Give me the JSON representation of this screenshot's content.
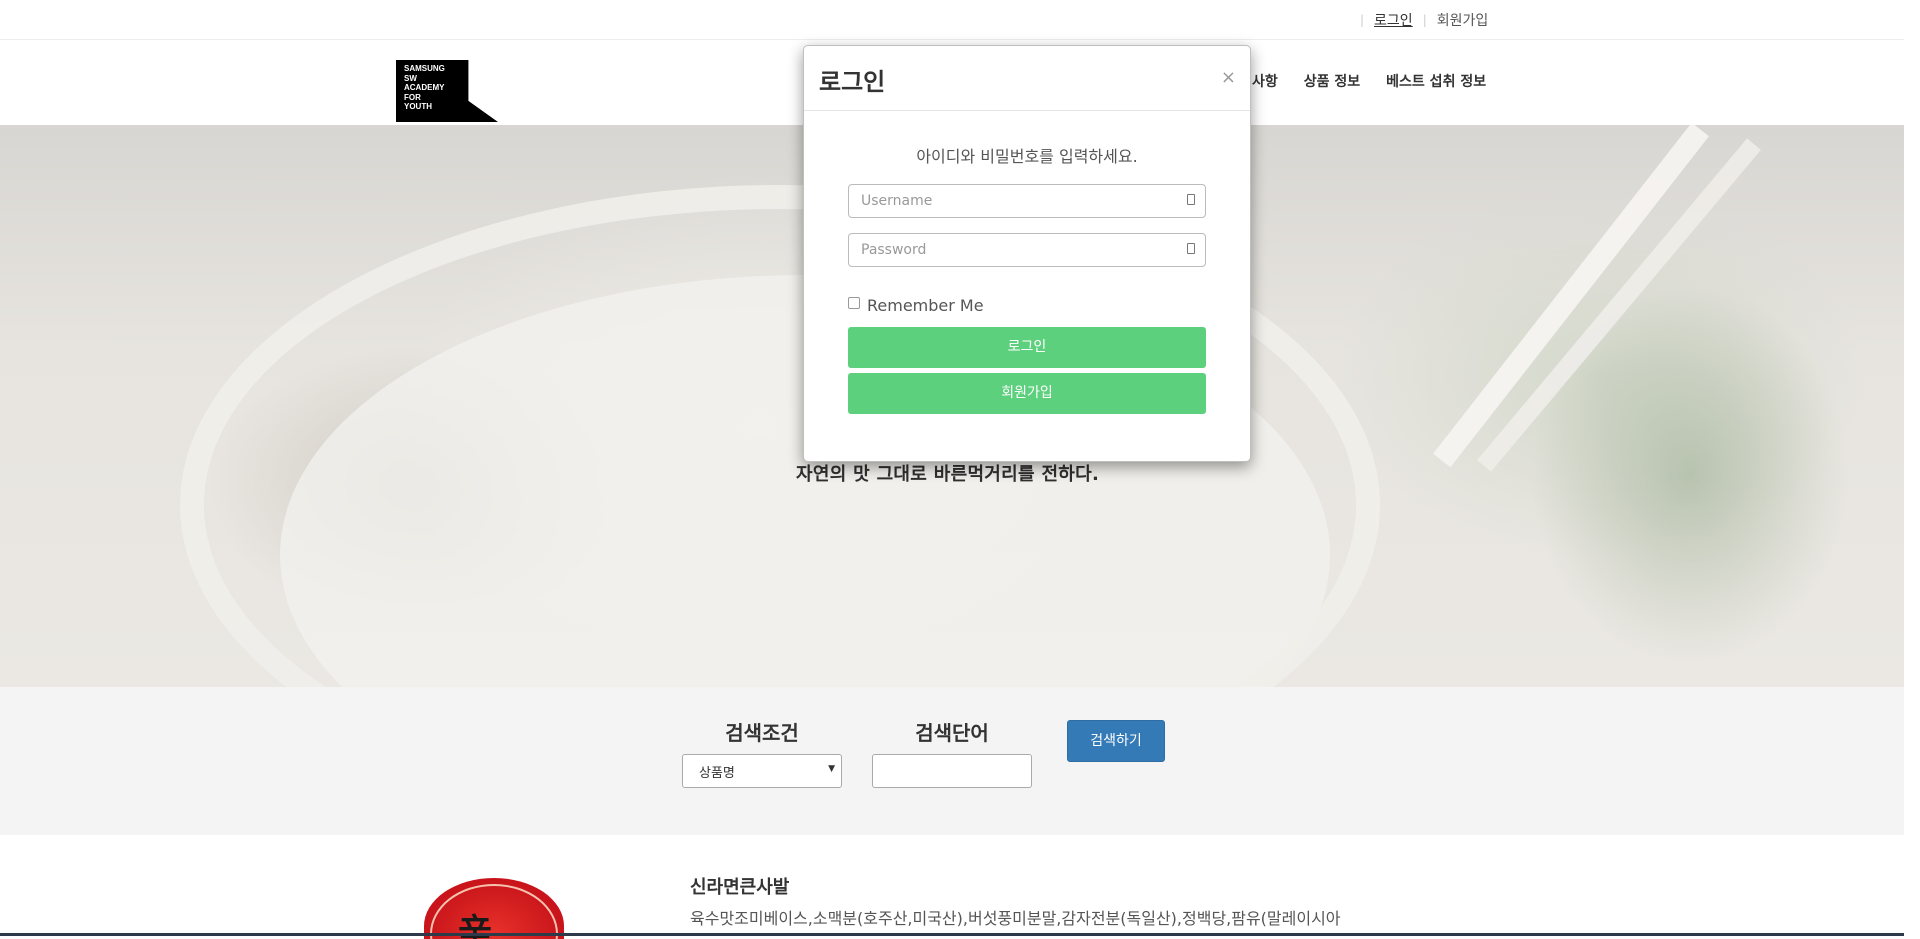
{
  "topbar": {
    "login_link": "로그인",
    "signup_link": "회원가입"
  },
  "header": {
    "logo_lines": [
      "SAMSUNG",
      "SW",
      "ACADEMY",
      "FOR",
      "YOUTH"
    ],
    "nav": [
      "사항",
      "상품 정보",
      "베스트 섭취 정보"
    ]
  },
  "hero": {
    "tagline": "자연의 맛 그대로 바른먹거리를 전하다."
  },
  "search": {
    "condition_label": "검색조건",
    "condition_value": "상품명",
    "keyword_label": "검색단어",
    "keyword_value": "",
    "button_label": "검색하기"
  },
  "product": {
    "name": "신라면큰사발",
    "description": "육수맛조미베이스,소맥분(호주산,미국산),버섯풍미분말,감자전분(독일산),정백당,팜유(말레이시아"
  },
  "modal": {
    "title": "로그인",
    "close_label": "×",
    "instruction": "아이디와 비밀번호를 입력하세요.",
    "username_placeholder": "Username",
    "password_placeholder": "Password",
    "remember_label": "Remember Me",
    "login_button": "로그인",
    "signup_button": "회원가입"
  },
  "colors": {
    "primary_button": "#337ab7",
    "green_button": "#5dd07e",
    "search_band": "#f4f4f4"
  }
}
